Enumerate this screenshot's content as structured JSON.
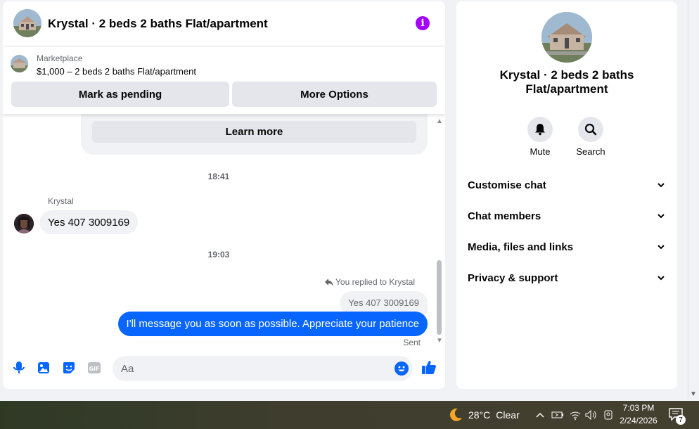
{
  "header": {
    "title": "Krystal · 2 beds 2 baths Flat/apartment"
  },
  "marketplace": {
    "label": "Marketplace",
    "listing": "$1,000 – 2 beds 2 baths Flat/apartment",
    "pending_button": "Mark as pending",
    "options_button": "More Options"
  },
  "messages": {
    "learn_more": "Learn more",
    "time_1": "18:41",
    "sender": "Krystal",
    "incoming_text": "Yes 407 3009169",
    "time_2": "19:03",
    "reply_note": "You replied to Krystal",
    "quoted_text": "Yes 407 3009169",
    "outgoing_text": "I'll message you as soon as possible. Appreciate your patience",
    "status": "Sent"
  },
  "composer": {
    "placeholder": "Aa"
  },
  "info_panel": {
    "title": "Krystal · 2 beds 2 baths Flat/apartment",
    "actions": [
      {
        "label": "Mute",
        "icon": "bell-icon"
      },
      {
        "label": "Search",
        "icon": "search-icon"
      }
    ],
    "sections": [
      {
        "label": "Customise chat"
      },
      {
        "label": "Chat members"
      },
      {
        "label": "Media, files and links"
      },
      {
        "label": "Privacy & support"
      }
    ]
  },
  "taskbar": {
    "temperature": "28°C",
    "weather": "Clear",
    "time": "7:03 PM",
    "date": "2/24/2026",
    "notification_count": "7"
  },
  "colors": {
    "accent": "#0866ff",
    "info_purple": "#a400ff",
    "bubble_gray": "#f0f2f5"
  }
}
